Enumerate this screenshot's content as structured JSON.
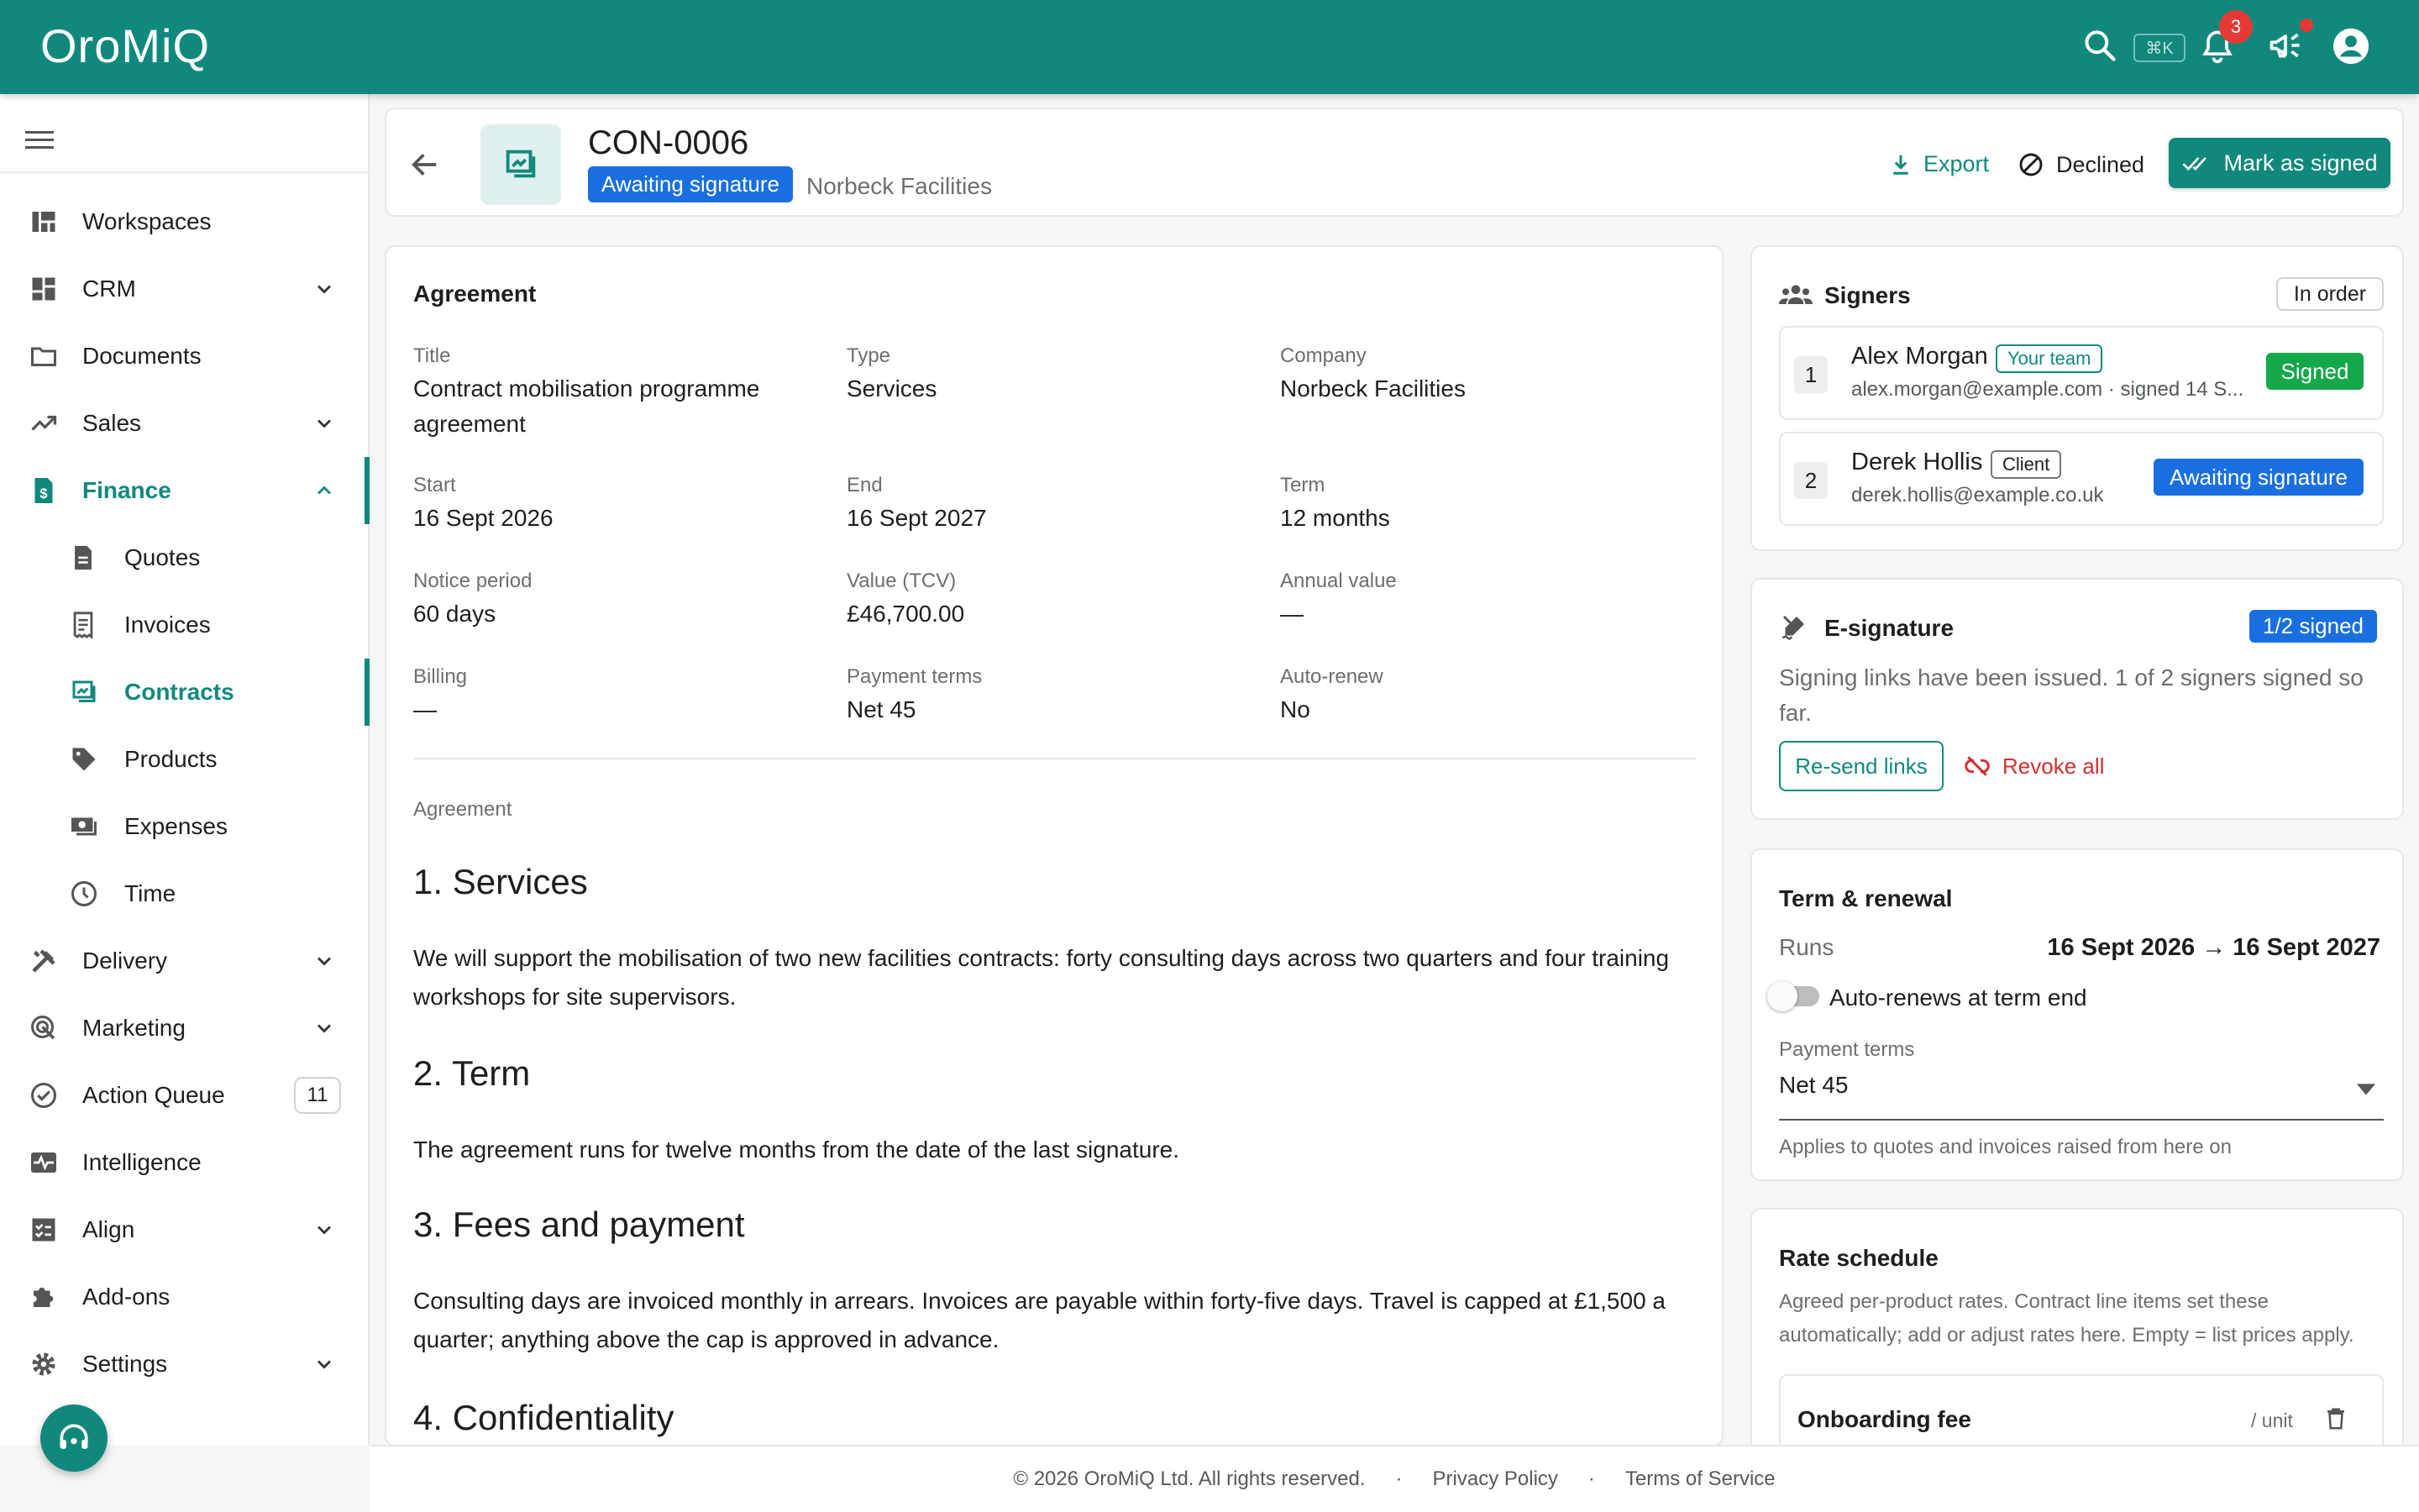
{
  "app": {
    "name": "OroMiQ"
  },
  "topbar": {
    "shortcut": "⌘K",
    "notifications_count": "3"
  },
  "sidebar": {
    "items": [
      {
        "label": "Workspaces"
      },
      {
        "label": "CRM"
      },
      {
        "label": "Documents"
      },
      {
        "label": "Sales"
      },
      {
        "label": "Finance"
      },
      {
        "label": "Quotes"
      },
      {
        "label": "Invoices"
      },
      {
        "label": "Contracts"
      },
      {
        "label": "Products"
      },
      {
        "label": "Expenses"
      },
      {
        "label": "Time"
      },
      {
        "label": "Delivery"
      },
      {
        "label": "Marketing"
      },
      {
        "label": "Action Queue",
        "count": "11"
      },
      {
        "label": "Intelligence"
      },
      {
        "label": "Align"
      },
      {
        "label": "Add-ons"
      },
      {
        "label": "Settings"
      }
    ]
  },
  "header": {
    "contract_id": "CON-0006",
    "status": "Awaiting signature",
    "company": "Norbeck Facilities",
    "export_label": "Export",
    "declined_label": "Declined",
    "mark_signed_label": "Mark as signed"
  },
  "agreement": {
    "section_title": "Agreement",
    "fields": [
      {
        "label": "Title",
        "value": "Contract mobilisation programme agreement"
      },
      {
        "label": "Type",
        "value": "Services"
      },
      {
        "label": "Company",
        "value": "Norbeck Facilities"
      },
      {
        "label": "Start",
        "value": "16 Sept 2026"
      },
      {
        "label": "End",
        "value": "16 Sept 2027"
      },
      {
        "label": "Term",
        "value": "12 months"
      },
      {
        "label": "Notice period",
        "value": "60 days"
      },
      {
        "label": "Value (TCV)",
        "value": "£46,700.00"
      },
      {
        "label": "Annual value",
        "value": "—"
      },
      {
        "label": "Billing",
        "value": "—"
      },
      {
        "label": "Payment terms",
        "value": "Net 45"
      },
      {
        "label": "Auto-renew",
        "value": "No"
      }
    ],
    "body_label": "Agreement",
    "sections": [
      {
        "heading": "1. Services",
        "text": "We will support the mobilisation of two new facilities contracts: forty consulting days across two quarters and four training workshops for site supervisors."
      },
      {
        "heading": "2. Term",
        "text": "The agreement runs for twelve months from the date of the last signature."
      },
      {
        "heading": "3. Fees and payment",
        "text": "Consulting days are invoiced monthly in arrears. Invoices are payable within forty-five days. Travel is capped at £1,500 a quarter; anything above the cap is approved in advance."
      },
      {
        "heading": "4. Confidentiality",
        "text": ""
      }
    ]
  },
  "signers": {
    "title": "Signers",
    "order_label": "In order",
    "list": [
      {
        "num": "1",
        "name": "Alex Morgan",
        "tag": "Your team",
        "email": "alex.morgan@example.com · signed 14 S...",
        "status": "Signed"
      },
      {
        "num": "2",
        "name": "Derek Hollis",
        "tag": "Client",
        "email": "derek.hollis@example.co.uk",
        "status": "Awaiting signature"
      }
    ]
  },
  "esign": {
    "title": "E-signature",
    "badge": "1/2 signed",
    "text": "Signing links have been issued. 1 of 2 signers signed so far.",
    "resend_label": "Re-send links",
    "revoke_label": "Revoke all"
  },
  "term": {
    "title": "Term & renewal",
    "runs_label": "Runs",
    "runs_value": "16 Sept 2026 → 16 Sept 2027",
    "autorenew_label": "Auto-renews at term end",
    "payment_label": "Payment terms",
    "payment_value": "Net 45",
    "helper": "Applies to quotes and invoices raised from here on"
  },
  "rates": {
    "title": "Rate schedule",
    "description": "Agreed per-product rates. Contract line items set these automatically; add or adjust rates here. Empty = list prices apply.",
    "items": [
      {
        "name": "Onboarding fee",
        "unit": "/ unit"
      }
    ]
  },
  "footer": {
    "copyright": "© 2026 OroMiQ Ltd. All rights reserved.",
    "sep": "·",
    "privacy": "Privacy Policy",
    "terms": "Terms of Service"
  },
  "colors": {
    "brand": "#10897c",
    "status_blue": "#1a6fe0",
    "signed_green": "#14a84a",
    "danger": "#d32f2f"
  }
}
